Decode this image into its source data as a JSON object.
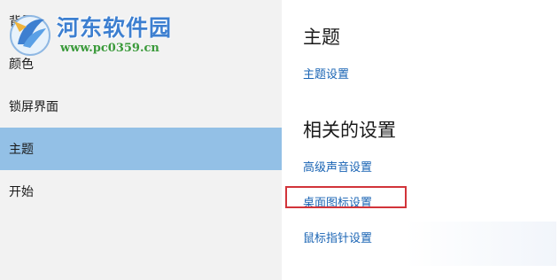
{
  "watermark": {
    "site_name": "河东软件园",
    "url": "www.pc0359.cn"
  },
  "sidebar": {
    "items": [
      {
        "label": "背景"
      },
      {
        "label": "颜色"
      },
      {
        "label": "锁屏界面"
      },
      {
        "label": "主题",
        "selected": true
      },
      {
        "label": "开始"
      }
    ]
  },
  "content": {
    "theme_heading": "主题",
    "theme_settings_link": "主题设置",
    "related_heading": "相关的设置",
    "related_links": [
      {
        "label": "高级声音设置"
      },
      {
        "label": "桌面图标设置",
        "highlighted": true
      },
      {
        "label": "鼠标指针设置"
      }
    ]
  },
  "colors": {
    "selected_background": "#93c0e6",
    "link": "#1a64b4",
    "highlight_border": "#d2343a",
    "watermark_title": "#3d7fd0",
    "watermark_url": "#3a9a3a"
  }
}
